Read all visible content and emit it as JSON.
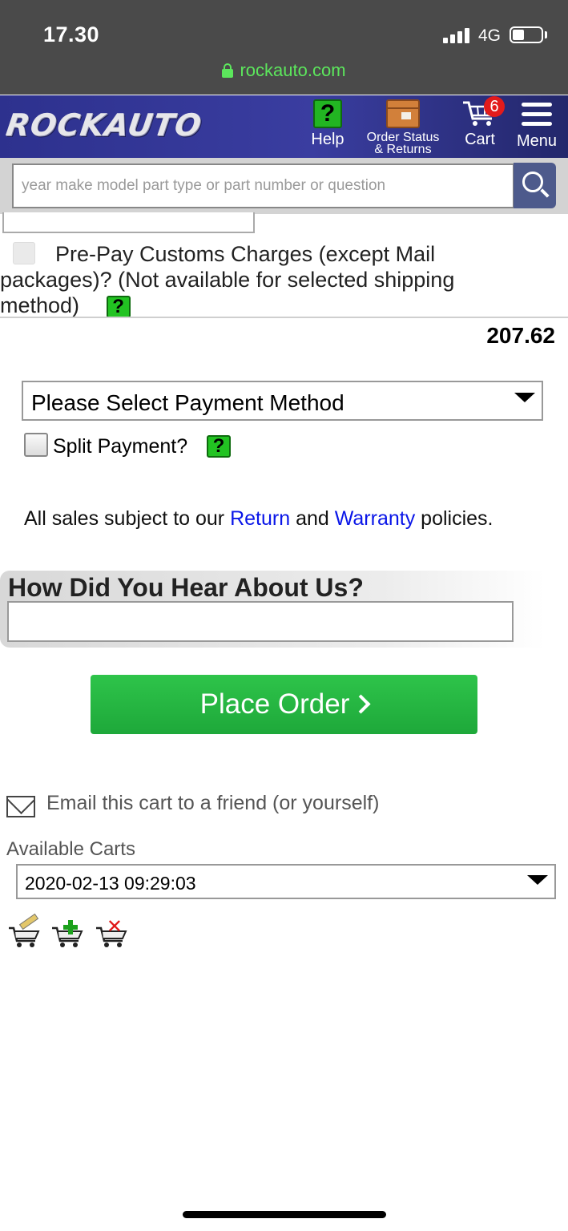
{
  "status_bar": {
    "time": "17.30",
    "network": "4G",
    "url": "rockauto.com"
  },
  "header": {
    "logo": "ROCKAUTO",
    "help_label": "Help",
    "order_status_line1": "Order Status",
    "order_status_line2": "& Returns",
    "cart_label": "Cart",
    "cart_count": "6",
    "menu_label": "Menu"
  },
  "search": {
    "placeholder": "year make model part type or part number or question"
  },
  "customs": {
    "line1": "Pre-Pay Customs Charges (except Mail",
    "line2": "packages)? (Not available for selected shipping",
    "line3": "method)",
    "help_glyph": "?",
    "checked": false
  },
  "order": {
    "total": "207.62"
  },
  "payment": {
    "selected": "Please Select Payment Method",
    "split_label": "Split Payment?",
    "split_checked": false
  },
  "policy": {
    "prefix": "All sales subject to our ",
    "return_link": "Return",
    "middle": " and ",
    "warranty_link": "Warranty",
    "suffix": " policies."
  },
  "hear_about": {
    "title": "How Did You Hear About Us?",
    "value": ""
  },
  "place_order": {
    "label": "Place Order"
  },
  "email": {
    "label": "Email this cart to a friend (or yourself)"
  },
  "carts": {
    "label": "Available Carts",
    "selected": "2020-02-13 09:29:03"
  },
  "colors": {
    "header_blue": "#2d318e",
    "green": "#22b522",
    "link_blue": "#0a16e8",
    "badge_red": "#e21b1b"
  }
}
